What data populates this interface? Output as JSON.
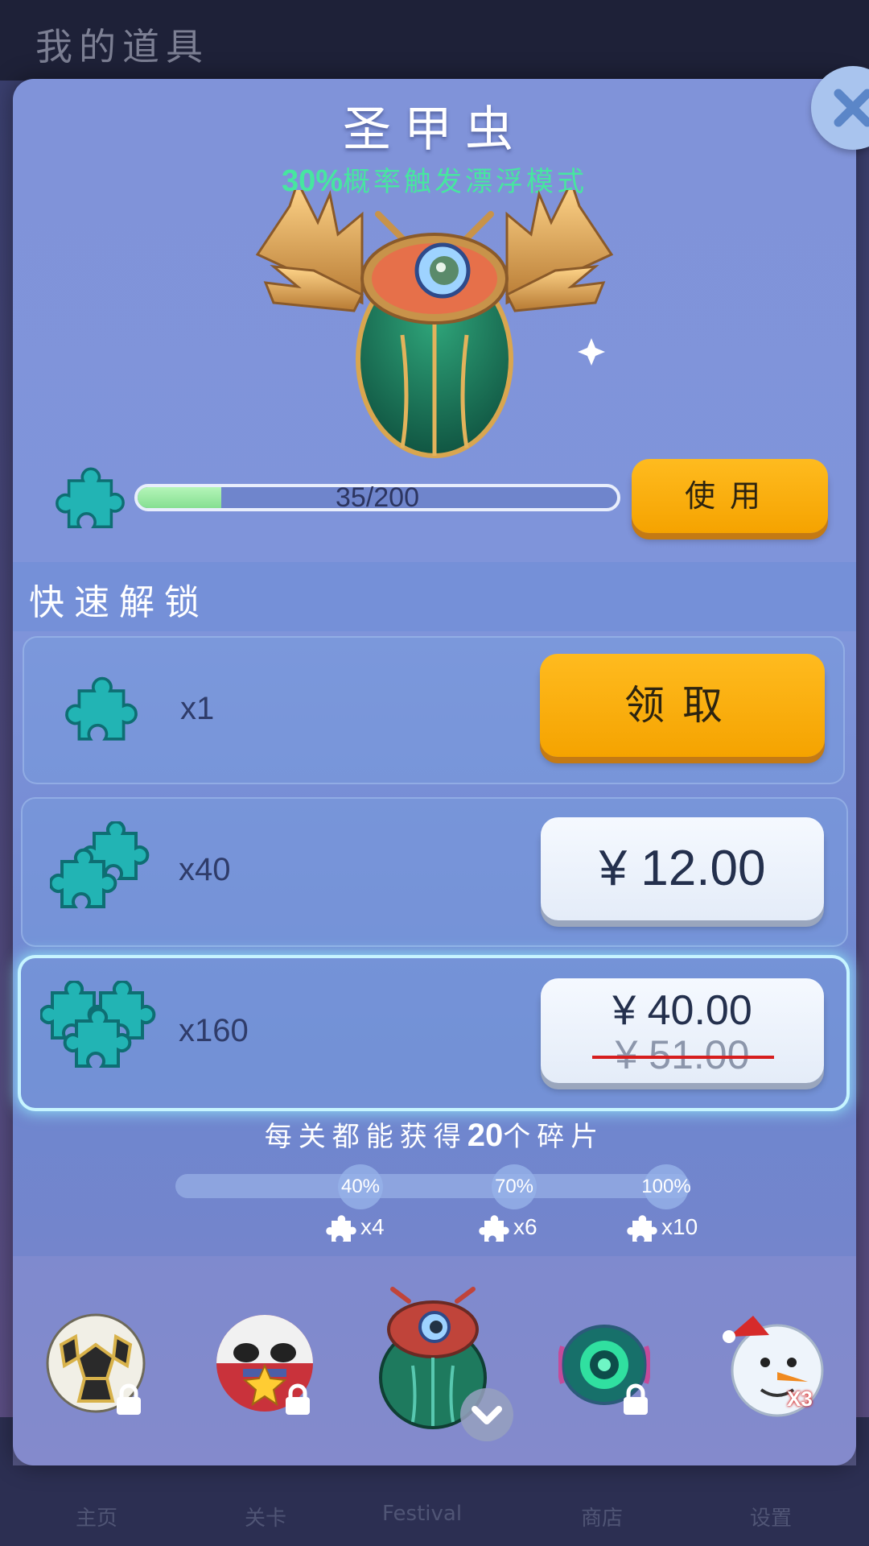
{
  "background": {
    "title": "我的道具",
    "nav": [
      "主页",
      "关卡",
      "Festival",
      "商店",
      "设置"
    ]
  },
  "modal": {
    "title": "圣甲虫",
    "subtitle_pct": "30%",
    "subtitle_text": "概率触发漂浮模式",
    "progress": {
      "text": "35/200",
      "value": 0.175
    },
    "use_label": "使用"
  },
  "quick_unlock": {
    "title": "快速解锁",
    "rows": [
      {
        "qty": "x1",
        "action": "领取"
      },
      {
        "qty": "x40",
        "price": "¥ 12.00"
      },
      {
        "qty": "x160",
        "price": "¥ 40.00",
        "old_price": "¥ 51.00"
      }
    ]
  },
  "per_level": {
    "pre": "每关都能获得",
    "num": "20",
    "post": "个碎片"
  },
  "milestones": [
    {
      "pct": "40%",
      "reward": "x4"
    },
    {
      "pct": "70%",
      "reward": "x6"
    },
    {
      "pct": "100%",
      "reward": "x10"
    }
  ],
  "skins": [
    {
      "icon": "soccer-ball-skin-icon",
      "locked": true
    },
    {
      "icon": "panda-ball-skin-icon",
      "locked": true
    },
    {
      "icon": "scarab-skin-icon",
      "locked": false
    },
    {
      "icon": "tech-eye-skin-icon",
      "locked": true
    },
    {
      "icon": "snowman-skin-icon",
      "badge": "X3"
    }
  ],
  "colors": {
    "accent_orange": "#f5a300",
    "subtitle_green": "#47e6a0",
    "strike_red": "#d61e1e"
  }
}
